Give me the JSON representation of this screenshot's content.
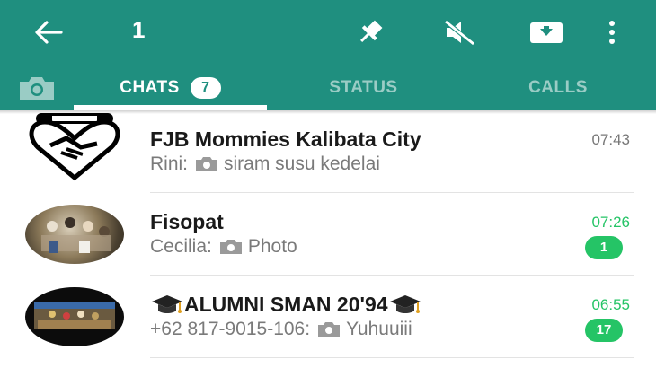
{
  "header": {
    "selection_count": "1",
    "icons": [
      "back-arrow-icon",
      "pin-icon",
      "mute-icon",
      "archive-icon",
      "more-vertical-icon"
    ]
  },
  "tabs": [
    {
      "label": "",
      "icon": "camera-icon"
    },
    {
      "label": "CHATS",
      "badge": "7",
      "active": true
    },
    {
      "label": "STATUS"
    },
    {
      "label": "CALLS"
    }
  ],
  "colors": {
    "accent": "#1f8f7f",
    "unread": "#25c466"
  },
  "chats": [
    {
      "name": "FJB Mommies Kalibata City",
      "sender": "Rini:",
      "preview": "siram susu kedelai",
      "has_photo_icon": true,
      "time": "07:43",
      "unread_count": "",
      "avatar": "handshake-heart-logo"
    },
    {
      "name": "Fisopat",
      "sender": "Cecilia:",
      "preview": "Photo",
      "has_photo_icon": true,
      "time": "07:26",
      "unread_count": "1",
      "avatar": "group-photo"
    },
    {
      "name": "ALUMNI SMAN 20'94",
      "name_prefix_icon": "graduation-cap-icon",
      "name_suffix_icon": "graduation-cap-icon",
      "sender": "+62 817-9015-106:",
      "preview": "Yuhuuiii",
      "has_photo_icon": true,
      "time": "06:55",
      "unread_count": "17",
      "avatar": "group-photo"
    }
  ]
}
